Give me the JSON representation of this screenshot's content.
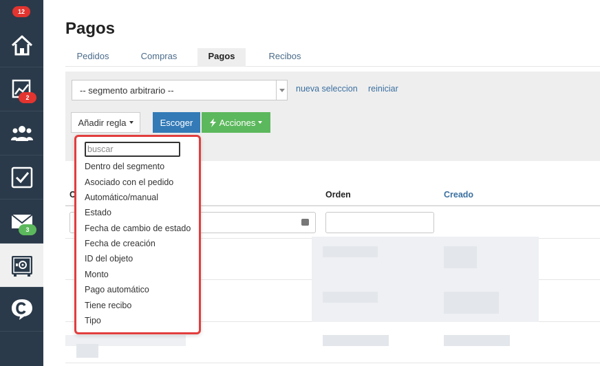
{
  "sidebar": {
    "badges": {
      "top": "12",
      "analytics": "2",
      "mail": "3"
    },
    "items": [
      {
        "icon": "home-icon"
      },
      {
        "icon": "chart-icon"
      },
      {
        "icon": "users-icon"
      },
      {
        "icon": "checkbox-icon"
      },
      {
        "icon": "mail-icon"
      },
      {
        "icon": "safe-icon"
      },
      {
        "icon": "chat-logo-icon"
      }
    ]
  },
  "page": {
    "title": "Pagos"
  },
  "tabs": [
    {
      "label": "Pedidos"
    },
    {
      "label": "Compras"
    },
    {
      "label": "Pagos",
      "active": true
    },
    {
      "label": "Recibos"
    }
  ],
  "filter": {
    "segment_select": "-- segmento arbitrario --",
    "new_selection": "nueva seleccion",
    "reset": "reiniciar",
    "add_rule": "Añadir regla",
    "choose": "Escoger",
    "actions": "Acciones"
  },
  "table": {
    "headers": {
      "col1": "C",
      "order": "Orden",
      "created": "Creado"
    }
  },
  "dropdown": {
    "search_placeholder": "buscar",
    "items": [
      "Dentro del segmento",
      "Asociado con el pedido",
      "Automático/manual",
      "Estado",
      "Fecha de cambio de estado",
      "Fecha de creación",
      "ID del objeto",
      "Monto",
      "Pago automático",
      "Tiene recibo",
      "Tipo"
    ]
  },
  "colors": {
    "sidebar": "#2b3a4a",
    "primary": "#337ab7",
    "success": "#5cb85c",
    "badge_red": "#e3342f",
    "highlight": "#e23d3d",
    "link": "#3a6fa0"
  }
}
